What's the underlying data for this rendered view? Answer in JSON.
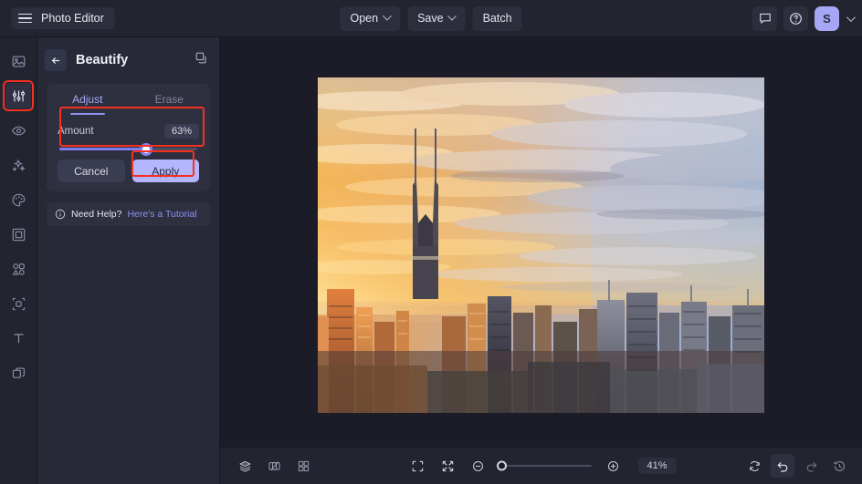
{
  "app": {
    "name": "Photo Editor",
    "menu_icon": "hamburger-icon"
  },
  "topbar": {
    "buttons": [
      {
        "label": "Open",
        "has_caret": true
      },
      {
        "label": "Save",
        "has_caret": true
      },
      {
        "label": "Batch",
        "has_caret": false
      }
    ],
    "right_icons": [
      "feedback-icon",
      "help-icon"
    ],
    "avatar_initial": "S"
  },
  "rail": {
    "items": [
      {
        "name": "image-icon",
        "active": false,
        "annotated": false
      },
      {
        "name": "adjust-sliders-icon",
        "active": true,
        "annotated": true
      },
      {
        "name": "eye-icon",
        "active": false,
        "annotated": false
      },
      {
        "name": "magic-sparkles-icon",
        "active": false,
        "annotated": false
      },
      {
        "name": "palette-icon",
        "active": false,
        "annotated": false
      },
      {
        "name": "frame-icon",
        "active": false,
        "annotated": false
      },
      {
        "name": "shapes-icon",
        "active": false,
        "annotated": false
      },
      {
        "name": "cutout-icon",
        "active": false,
        "annotated": false
      },
      {
        "name": "text-icon",
        "active": false,
        "annotated": false
      },
      {
        "name": "layers-icon",
        "active": false,
        "annotated": false
      }
    ]
  },
  "panel": {
    "title": "Beautify",
    "back_icon": "back-arrow-icon",
    "duplicate_icon": "duplicate-icon",
    "tabs": [
      {
        "label": "Adjust",
        "active": true
      },
      {
        "label": "Erase",
        "active": false
      }
    ],
    "slider": {
      "label": "Amount",
      "value_text": "63%",
      "value": 63,
      "min": 0,
      "max": 100
    },
    "cancel_label": "Cancel",
    "apply_label": "Apply",
    "help": {
      "icon": "info-icon",
      "text": "Need Help?",
      "link": "Here's a Tutorial"
    }
  },
  "bottombar": {
    "left_icons": [
      "layers-panel-icon",
      "compare-icon",
      "grid-icon"
    ],
    "center_icons": [
      "fit-screen-icon",
      "shrink-icon"
    ],
    "zoom_out_icon": "zoom-out-icon",
    "zoom_in_icon": "zoom-in-icon",
    "zoom_value": "41%",
    "zoom_percent": 41,
    "right_icons": [
      "reset-icon",
      "undo-icon",
      "redo-icon",
      "history-icon"
    ]
  },
  "canvas": {
    "photo_alt": "sunset-city-skyline"
  },
  "colors": {
    "accent": "#8f91ee",
    "apply_button": "#b4b6fb",
    "annotation": "#f4311f",
    "panel_bg": "#272936",
    "canvas_bg": "#1b1c27",
    "topbar_bg": "#23242f"
  }
}
